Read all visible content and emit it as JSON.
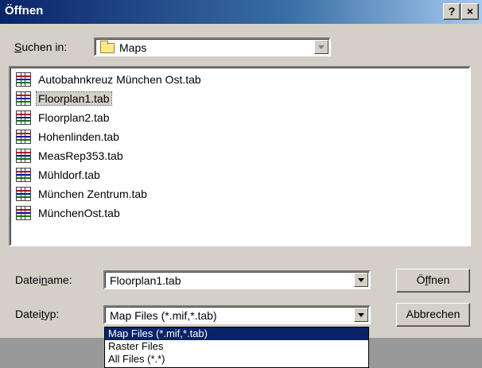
{
  "dialog": {
    "title": "Öffnen",
    "help_button": "?",
    "close_button": "×"
  },
  "look_in": {
    "label_pre": "",
    "label_accel": "S",
    "label_post": "uchen in:",
    "value": "Maps",
    "icon": "folder-icon"
  },
  "files": [
    {
      "name": "Autobahnkreuz München Ost.tab",
      "selected": false
    },
    {
      "name": "Floorplan1.tab",
      "selected": true
    },
    {
      "name": "Floorplan2.tab",
      "selected": false
    },
    {
      "name": "Hohenlinden.tab",
      "selected": false
    },
    {
      "name": "MeasRep353.tab",
      "selected": false
    },
    {
      "name": "Mühldorf.tab",
      "selected": false
    },
    {
      "name": "München Zentrum.tab",
      "selected": false
    },
    {
      "name": "MünchenOst.tab",
      "selected": false
    }
  ],
  "filename": {
    "label_pre": "Datei",
    "label_accel": "n",
    "label_post": "ame:",
    "value": "Floorplan1.tab"
  },
  "filetype": {
    "label_pre": "Datei",
    "label_accel": "t",
    "label_post": "yp:",
    "value": "Map Files (*.mif,*.tab)",
    "options": [
      "Map Files (*.mif,*.tab)",
      "Raster Files",
      "All Files (*.*)"
    ],
    "selected_index": 0
  },
  "buttons": {
    "open_pre": "Ö",
    "open_accel": "f",
    "open_post": "fnen",
    "cancel": "Abbrechen"
  }
}
